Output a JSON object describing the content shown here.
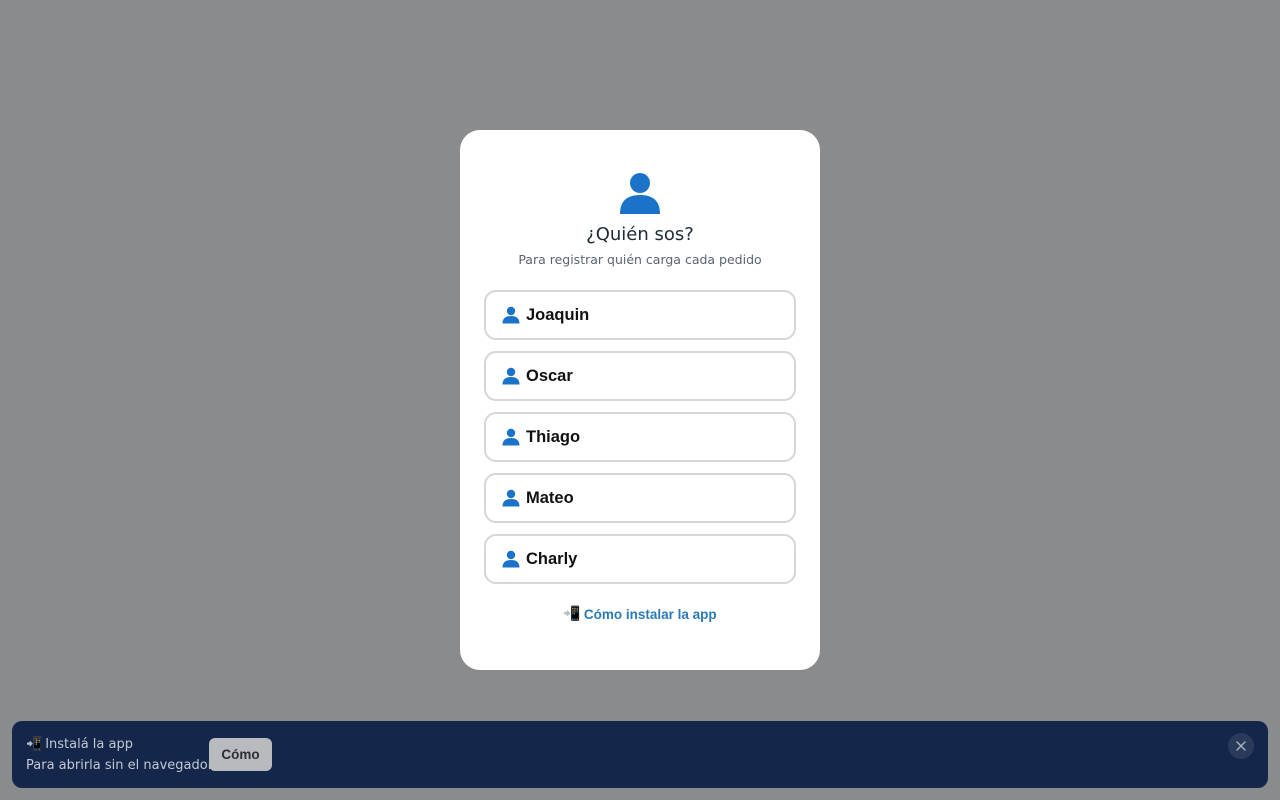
{
  "modal": {
    "icon": "user-icon",
    "title": "¿Quién sos?",
    "subtitle": "Para registrar quién carga cada pedido",
    "users": [
      {
        "name": "Joaquin",
        "icon": "user-icon"
      },
      {
        "name": "Oscar",
        "icon": "user-icon"
      },
      {
        "name": "Thiago",
        "icon": "user-icon"
      },
      {
        "name": "Mateo",
        "icon": "user-icon"
      },
      {
        "name": "Charly",
        "icon": "user-icon"
      }
    ],
    "install_link": {
      "icon": "📲",
      "label": "Cómo instalar la app"
    }
  },
  "banner": {
    "icon": "📲",
    "title": "Instalá la app",
    "description": "Para abrirla sin el navegador.",
    "button_label": "Cómo",
    "close_icon": "close-icon"
  },
  "colors": {
    "overlay": "#8a8b8d",
    "accent": "#1a73c9",
    "link": "#2a7ab8",
    "banner_bg": "#14264a"
  }
}
